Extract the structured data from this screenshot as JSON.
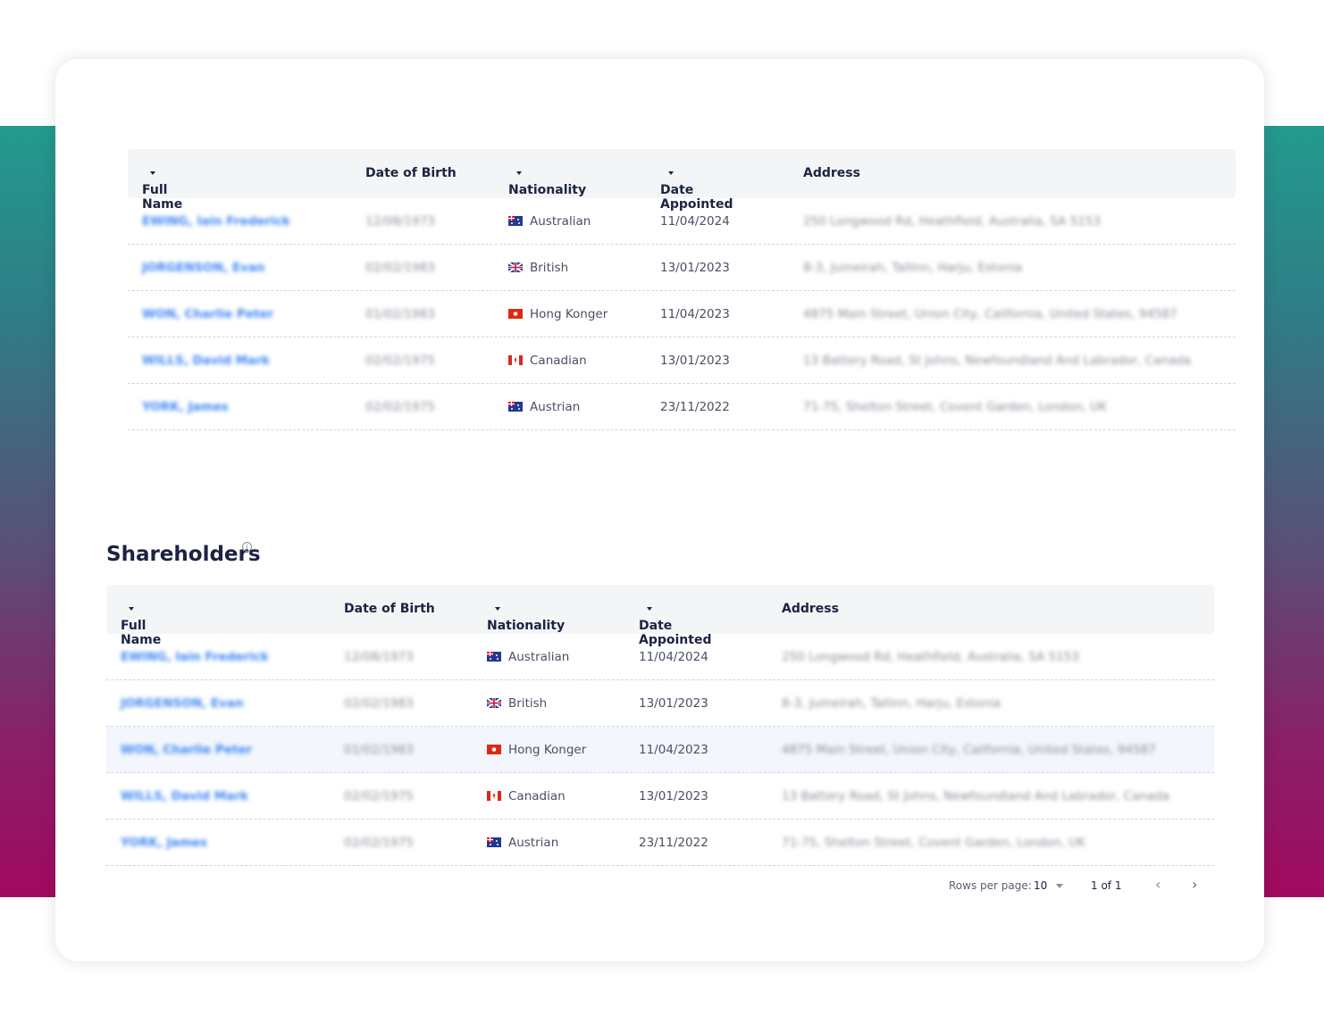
{
  "columns": {
    "full_name": "Full Name",
    "dob": "Date of Birth",
    "nationality": "Nationality",
    "date_appointed": "Date Appointed",
    "address": "Address"
  },
  "colors": {
    "link": "#3d86f5",
    "band_top": "#239a8e",
    "band_bottom": "#a10a5f"
  },
  "officers": [
    {
      "name": "EWING, Iain Frederick",
      "dob": "12/08/1973",
      "nationality": "Australian",
      "flag": "au",
      "appointed": "11/04/2024",
      "address": "250 Longwood Rd, Heathfield, Australia, SA 5153"
    },
    {
      "name": "JORGENSON, Evan",
      "dob": "02/02/1983",
      "nationality": "British",
      "flag": "gb",
      "appointed": "13/01/2023",
      "address": "8-3, Jumeirah, Tallinn, Harju, Estonia"
    },
    {
      "name": "WON, Charlie Peter",
      "dob": "01/02/1983",
      "nationality": "Hong Konger",
      "flag": "hk",
      "appointed": "11/04/2023",
      "address": "4875 Main Street, Union City, California, United States, 94587"
    },
    {
      "name": "WILLS, David Mark",
      "dob": "02/02/1975",
      "nationality": "Canadian",
      "flag": "ca",
      "appointed": "13/01/2023",
      "address": "13 Battery Road, St Johns, Newfoundland And Labrador, Canada"
    },
    {
      "name": "YORK, James",
      "dob": "02/02/1975",
      "nationality": "Austrian",
      "flag": "au",
      "appointed": "23/11/2022",
      "address": "71-75, Shelton Street, Covent Garden, London, UK"
    }
  ],
  "shareholders": {
    "title": "Shareholders",
    "info_icon": "info-icon",
    "highlighted_row": 2,
    "rows_per_page_label": "Rows per page:",
    "rows_per_page": "10",
    "page_info": "1 of 1"
  }
}
